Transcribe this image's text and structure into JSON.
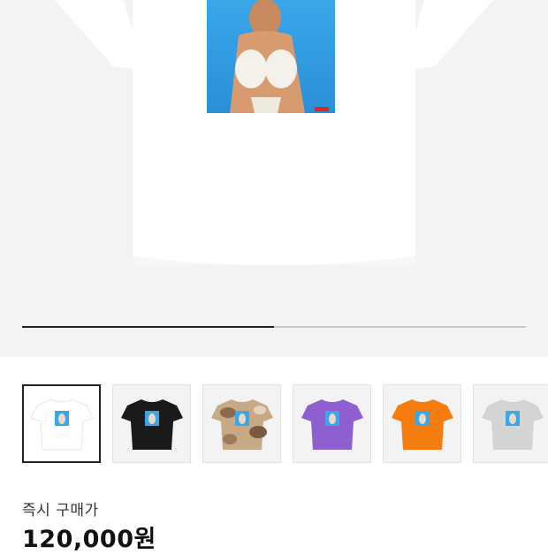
{
  "gallery": {
    "image_progress_fraction": 0.5,
    "hero_shirt_color": "#ffffff",
    "thumbnails": [
      {
        "color": "#ffffff",
        "variant": "white",
        "selected": true
      },
      {
        "color": "#1a1a1a",
        "variant": "black",
        "selected": false
      },
      {
        "color": "#b08d6a",
        "variant": "camo",
        "selected": false
      },
      {
        "color": "#8e5fcf",
        "variant": "purple",
        "selected": false
      },
      {
        "color": "#f57c0f",
        "variant": "orange",
        "selected": false
      },
      {
        "color": "#d4d4d4",
        "variant": "grey",
        "selected": false
      }
    ]
  },
  "price": {
    "label": "즉시 구매가",
    "value": "120,000원"
  }
}
